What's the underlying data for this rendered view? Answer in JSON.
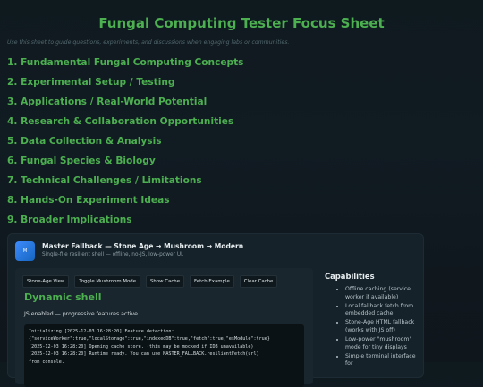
{
  "page": {
    "title": "Fungal Computing Tester Focus Sheet",
    "subtitle": "Use this sheet to guide questions, experiments, and discussions when engaging labs or communities."
  },
  "topics": [
    "1. Fundamental Fungal Computing Concepts",
    "2. Experimental Setup / Testing",
    "3. Applications / Real-World Potential",
    "4. Research & Collaboration Opportunities",
    "5. Data Collection & Analysis",
    "6. Fungal Species & Biology",
    "7. Technical Challenges / Limitations",
    "8. Hands-On Experiment Ideas",
    "9. Broader Implications"
  ],
  "app": {
    "icon_label": "M",
    "title": "Master Fallback — Stone Age → Mushroom → Modern",
    "subtitle": "Single-file resilient shell — offline, no-JS, low-power UI."
  },
  "toolbar": [
    "Stone-Age View",
    "Toggle Mushroom Mode",
    "Show Cache",
    "Fetch Example",
    "Clear Cache"
  ],
  "main": {
    "heading": "Dynamic shell",
    "status": "JS enabled — progressive features active.",
    "log_lines": [
      "Initializing…[2025-12-03 16:28:20] Feature detection:",
      "{\"serviceWorker\":true,\"localStorage\":true,\"indexedDB\":true,\"fetch\":true,\"esModule\":true}",
      "[2025-12-03 16:28:20] Opening cache store. (this may be mocked if IDB unavailable)",
      "[2025-12-03 16:28:20] Runtime ready. You can use MASTER_FALLBACK.resilientFetch(url)",
      "from console."
    ]
  },
  "capabilities": {
    "title": "Capabilities",
    "items": [
      "Offline caching (service worker if available)",
      "Local fallback fetch from embedded cache",
      "Stone-Age HTML fallback (works with JS off)",
      "Low-power \"mushroom\" mode for tiny displays",
      "Simple terminal interface for"
    ]
  }
}
